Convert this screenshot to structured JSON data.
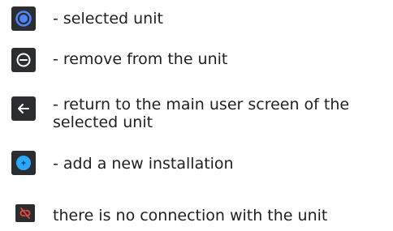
{
  "legend": {
    "items": [
      {
        "icon": "selected-unit-icon",
        "text": "- selected unit"
      },
      {
        "icon": "remove-circle-icon",
        "text": "- remove from the unit"
      },
      {
        "icon": "arrow-left-icon",
        "text": "- return to the main user screen of the selected unit"
      },
      {
        "icon": "add-circle-icon",
        "text": "- add a new installation"
      },
      {
        "icon": "link-broken-icon",
        "text": "there is no connection with the unit"
      }
    ]
  },
  "colors": {
    "icon_background": "#2b2d31",
    "selected_ring": "#4f86ff",
    "add_circle": "#2aa7ff",
    "no_connection": "#e8473f",
    "text": "#1f1f1f"
  }
}
